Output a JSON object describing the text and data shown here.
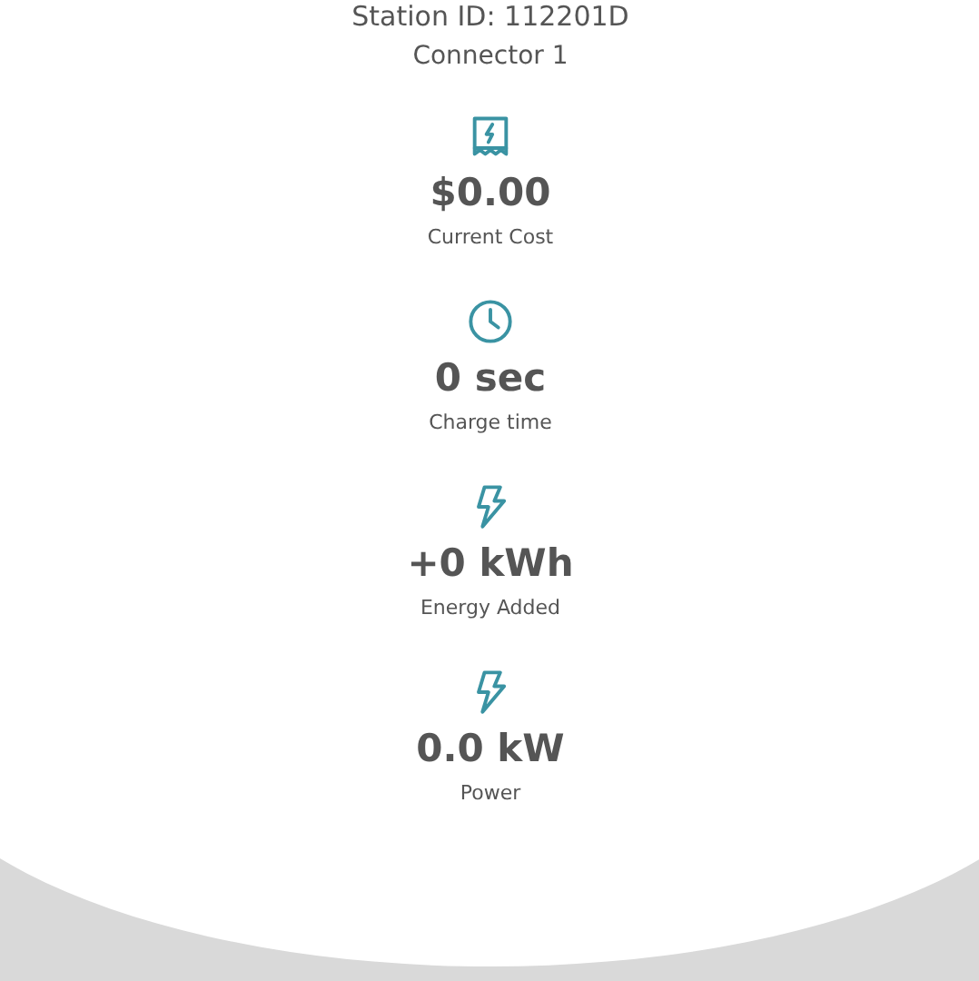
{
  "station_id": "Station ID: 112201D",
  "connector": "Connector 1",
  "stats": [
    {
      "kind": "receipt",
      "value": "$0.00",
      "label": "Current Cost"
    },
    {
      "kind": "clock",
      "value": "0 sec",
      "label": "Charge time"
    },
    {
      "kind": "bolt",
      "value": "+0 kWh",
      "label": "Energy Added"
    },
    {
      "kind": "bolt",
      "value": "0.0 kW",
      "label": "Power"
    }
  ]
}
